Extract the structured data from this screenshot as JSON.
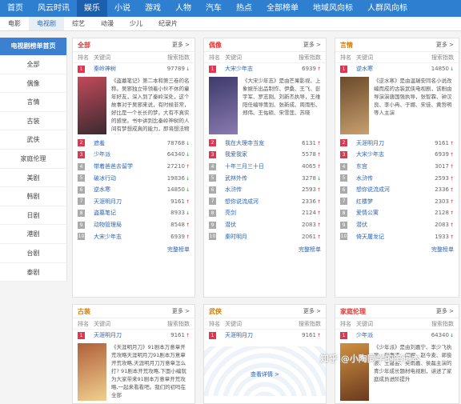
{
  "topnav": [
    "首页",
    "风云时讯",
    "娱乐",
    "小说",
    "游戏",
    "人物",
    "汽车",
    "热点",
    "全部榜单",
    "地域风向标",
    "人群风向标"
  ],
  "topnav_active": 2,
  "subnav": [
    "电影",
    "电视剧",
    "综艺",
    "动漫",
    "少儿",
    "纪录片"
  ],
  "subnav_active": 1,
  "sidebar": {
    "title": "电视剧榜单首页",
    "items": [
      "全部",
      "偶像",
      "言情",
      "古装",
      "武侠",
      "家庭伦理",
      "美剧",
      "韩剧",
      "日剧",
      "港剧",
      "台剧",
      "泰剧"
    ]
  },
  "columns": {
    "rank": "排名",
    "kw": "关键词",
    "idx": "搜索指数"
  },
  "more": "更多 >",
  "complete": "完整榜单",
  "check_more": "查看详情 >",
  "cards": [
    {
      "title": "全部",
      "title_color": "#e23838",
      "feat": {
        "name": "秦岭神树",
        "value": "97789",
        "dir": "down",
        "desc": "《盗墓笔记》第二本和第三卷的名称。吴邪独立带领着小伙不休的童年好友，深入到了秦岭深处，这个故事对于吴邪来说，有时候非常，好比是一个长长的梦。大有不真实的感觉。书中讲到比秦岭神树的人间有梦想成真的能力，即将想法物质化，甚至可以\"创造\"另一"
      },
      "rows": [
        [
          "2",
          "遮羞",
          "78768",
          "down"
        ],
        [
          "3",
          "少年派",
          "64340",
          "down"
        ],
        [
          "4",
          "带着爸爸去留学",
          "27210",
          "up"
        ],
        [
          "5",
          "破冰行动",
          "19836",
          "down"
        ],
        [
          "6",
          "逆水寒",
          "14850",
          "down"
        ],
        [
          "7",
          "天涯明月刀",
          "9161",
          "up"
        ],
        [
          "8",
          "盗墓笔记",
          "8933",
          "down"
        ],
        [
          "9",
          "动物管理局",
          "8548",
          "up"
        ],
        [
          "10",
          "大宋少年志",
          "6939",
          "up"
        ]
      ]
    },
    {
      "title": "偶像",
      "title_color": "#e23838",
      "feat": {
        "name": "大宋少年志",
        "value": "6939",
        "dir": "up",
        "desc": "《大宋少年志》是由芒果影视、上象娱乐出品制作、伊桑、王飞、彭宇军、罗志刚、刘新杰执导，王维阳任编导策划、张新成、周雨彤、郑伟、王佑硕、宋雪莲、苏晓"
      },
      "rows": [
        [
          "2",
          "我在大理寺当宠",
          "6131",
          "up"
        ],
        [
          "3",
          "我爱我家",
          "5578",
          "up"
        ],
        [
          "4",
          "十年三月三十日",
          "4065",
          "up"
        ],
        [
          "5",
          "武林外传",
          "3278",
          "down"
        ],
        [
          "6",
          "水浒传",
          "2593",
          "up"
        ],
        [
          "7",
          "想你说流成河",
          "2336",
          "up"
        ],
        [
          "8",
          "亮剑",
          "2124",
          "up"
        ],
        [
          "9",
          "潜伏",
          "2083",
          "up"
        ],
        [
          "10",
          "秦时明月",
          "2061",
          "up"
        ]
      ]
    },
    {
      "title": "言情",
      "title_color": "#d97a00",
      "feat": {
        "name": "逆水寒",
        "value": "14850",
        "dir": "down",
        "desc": "《逆水寒》是由温瑞安同名小说改编而成的古装武侠电视剧，该剧由导演演唐国强执导，张智霖、钟汉良、李小冉、于娜、宋佳、黄哲明等人主演"
      },
      "rows": [
        [
          "2",
          "天涯明月刀",
          "9161",
          "up"
        ],
        [
          "3",
          "大宋少年志",
          "6939",
          "up"
        ],
        [
          "4",
          "东宫",
          "3017",
          "up"
        ],
        [
          "5",
          "水浒传",
          "2593",
          "up"
        ],
        [
          "6",
          "想你说流成河",
          "2336",
          "up"
        ],
        [
          "7",
          "红楼梦",
          "2303",
          "up"
        ],
        [
          "8",
          "爱情公寓",
          "2128",
          "up"
        ],
        [
          "9",
          "潜伏",
          "2083",
          "up"
        ],
        [
          "10",
          "倚天屠龙记",
          "1933",
          "up"
        ]
      ]
    },
    {
      "title": "古装",
      "title_color": "#d97a00",
      "feat": {
        "name": "天涯明月刀",
        "value": "9161",
        "dir": "up",
        "desc": "《天涯明月刀》91剧本万意章开荒攻略天涯明月刀91剧本万意章开荒攻略,天涯明月刀万意章怎么打? 91剧本开荒攻略,下面小编就为大家带来91剧本万意章开荒攻略,一起来看看吧。我们的初吗在全部"
      },
      "rows": []
    },
    {
      "title": "武侠",
      "title_color": "#d97a00",
      "feat": null,
      "rows": [
        [
          "1",
          "天涯明月刀",
          "9161",
          "up"
        ]
      ]
    },
    {
      "title": "家庭伦理",
      "title_color": "#e23838",
      "feat": {
        "name": "少年派",
        "value": "64340",
        "dir": "down",
        "desc": "《少年派》是由刘嘉宁、李少飞执导，张嘉译、闫妮、赵今麦、郭俊辰、王嘉芸、吴雨嘉、侯磊主演的青少年成长题材电视剧，讲述了家庭成员进阶提升"
      },
      "rows": []
    }
  ],
  "watermark": "知乎 @小陶同学的笔记本",
  "colors": {
    "nav": "#2f7fd0",
    "rank_top": "#e2364f",
    "rank_mid": "#7a4fd1",
    "rank_rest": "#aaaaaa"
  }
}
